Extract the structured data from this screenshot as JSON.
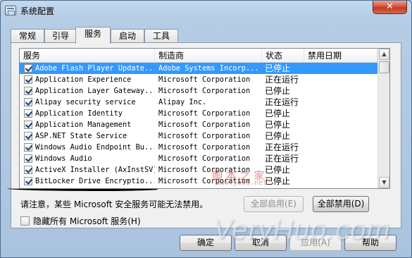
{
  "window": {
    "title": "系统配置",
    "close_label": "✕"
  },
  "tabs": [
    {
      "label": "常规",
      "active": false
    },
    {
      "label": "引导",
      "active": false
    },
    {
      "label": "服务",
      "active": true
    },
    {
      "label": "启动",
      "active": false
    },
    {
      "label": "工具",
      "active": false
    }
  ],
  "table": {
    "columns": [
      "服务",
      "制造商",
      "状态",
      "禁用日期"
    ],
    "rows": [
      {
        "name": "Adobe Flash Player Update...",
        "manufacturer": "Adobe Systems Incorp...",
        "status": "已停止",
        "checked": true,
        "selected": true
      },
      {
        "name": "Application Experience",
        "manufacturer": "Microsoft Corporation",
        "status": "正在运行",
        "checked": true,
        "selected": false
      },
      {
        "name": "Application Layer Gateway...",
        "manufacturer": "Microsoft Corporation",
        "status": "已停止",
        "checked": true,
        "selected": false
      },
      {
        "name": "Alipay security service",
        "manufacturer": "Alipay Inc.",
        "status": "正在运行",
        "checked": true,
        "selected": false
      },
      {
        "name": "Application Identity",
        "manufacturer": "Microsoft Corporation",
        "status": "已停止",
        "checked": true,
        "selected": false
      },
      {
        "name": "Application Management",
        "manufacturer": "Microsoft Corporation",
        "status": "已停止",
        "checked": true,
        "selected": false
      },
      {
        "name": "ASP.NET State Service",
        "manufacturer": "Microsoft Corporation",
        "status": "已停止",
        "checked": true,
        "selected": false
      },
      {
        "name": "Windows Audio Endpoint Bu...",
        "manufacturer": "Microsoft Corporation",
        "status": "正在运行",
        "checked": true,
        "selected": false
      },
      {
        "name": "Windows Audio",
        "manufacturer": "Microsoft Corporation",
        "status": "正在运行",
        "checked": true,
        "selected": false
      },
      {
        "name": "ActiveX Installer (AxInstSV)",
        "manufacturer": "Microsoft Corporation",
        "status": "已停止",
        "checked": true,
        "selected": false
      },
      {
        "name": "BitLocker Drive Encryptio...",
        "manufacturer": "Microsoft Corporation",
        "status": "已停止",
        "checked": true,
        "selected": false
      }
    ]
  },
  "note": "请注意，某些 Microsoft 安全服务可能无法禁用。",
  "buttons": {
    "enable_all": "全部启用(E)",
    "disable_all": "全部禁用(D)",
    "ok": "确定",
    "cancel": "取消",
    "apply": "应用(A)",
    "help": "帮助"
  },
  "hide_ms": {
    "label": "隐藏所有 Microsoft 服务(H)",
    "checked": false
  },
  "watermarks": {
    "cn": "脚 本 之 家",
    "url": "www.jb51.net",
    "brand": "VeryHuo.com"
  },
  "colors": {
    "selection": "#3399ff",
    "close_button": "#c33a21"
  }
}
